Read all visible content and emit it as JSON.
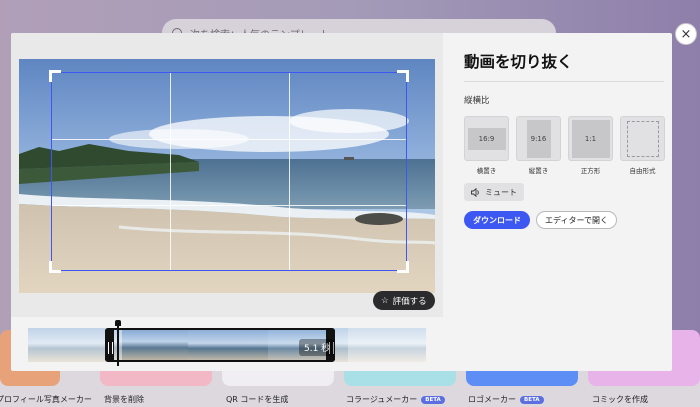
{
  "background": {
    "search_placeholder": "次を検索：人気のテンプレート",
    "tools": [
      {
        "label": "プロフィール写真メーカー",
        "beta": ""
      },
      {
        "label": "背景を削除",
        "beta": ""
      },
      {
        "label": "QR コードを生成",
        "beta": ""
      },
      {
        "label": "コラージュメーカー",
        "beta": "BETA"
      },
      {
        "label": "ロゴメーカー",
        "beta": "BETA"
      },
      {
        "label": "コミックを作成",
        "beta": ""
      }
    ]
  },
  "modal": {
    "title": "動画を切り抜く",
    "close_icon": "×",
    "aspect_label": "縦横比",
    "ratios": [
      {
        "box": "16:9",
        "label": "横置き"
      },
      {
        "box": "9:16",
        "label": "縦置き"
      },
      {
        "box": "1:1",
        "label": "正方形"
      },
      {
        "box": "",
        "label": "自由形式"
      }
    ],
    "mute_label": "ミュート",
    "download_label": "ダウンロード",
    "open_editor_label": "エディターで開く",
    "rate_label": "評価する",
    "duration": "5.1 秒"
  },
  "colors": {
    "accent": "#3d57f2",
    "crop_border": "#3d57f2"
  }
}
